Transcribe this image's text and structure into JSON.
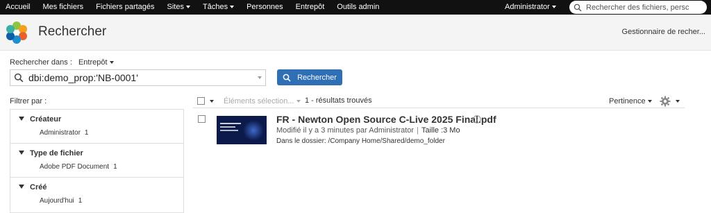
{
  "nav": {
    "items": [
      {
        "label": "Accueil",
        "dropdown": false
      },
      {
        "label": "Mes fichiers",
        "dropdown": false
      },
      {
        "label": "Fichiers partagés",
        "dropdown": false
      },
      {
        "label": "Sites",
        "dropdown": true
      },
      {
        "label": "Tâches",
        "dropdown": true
      },
      {
        "label": "Personnes",
        "dropdown": false
      },
      {
        "label": "Entrepôt",
        "dropdown": false
      },
      {
        "label": "Outils admin",
        "dropdown": false
      }
    ],
    "user": "Administrator",
    "search_placeholder": "Rechercher des fichiers, persc"
  },
  "header": {
    "title": "Rechercher",
    "manager_link": "Gestionnaire de recher..."
  },
  "search": {
    "in_label": "Rechercher dans :",
    "scope": "Entrepôt",
    "query": "dbi:demo_prop:'NB-0001'",
    "button_label": "Rechercher"
  },
  "filter": {
    "label": "Filtrer par :",
    "facets": [
      {
        "title": "Créateur",
        "item": "Administrator",
        "count": "1"
      },
      {
        "title": "Type de fichier",
        "item": "Adobe PDF Document",
        "count": "1"
      },
      {
        "title": "Créé",
        "item": "Aujourd'hui",
        "count": "1"
      }
    ]
  },
  "results": {
    "selection_label": "Éléments sélection...",
    "count_text": "1 - résultats trouvés",
    "sort_label": "Pertinence",
    "items": [
      {
        "title": "FR - Newton Open Source C-Live 2025 Final.pdf",
        "modified": "Modifié il y a 3 minutes par Administrator",
        "size": "Taille :3 Mo",
        "folder": "Dans le dossier: /Company Home/Shared/demo_folder"
      }
    ]
  },
  "colors": {
    "topbar": "#111111",
    "accent": "#2f6fb5"
  }
}
